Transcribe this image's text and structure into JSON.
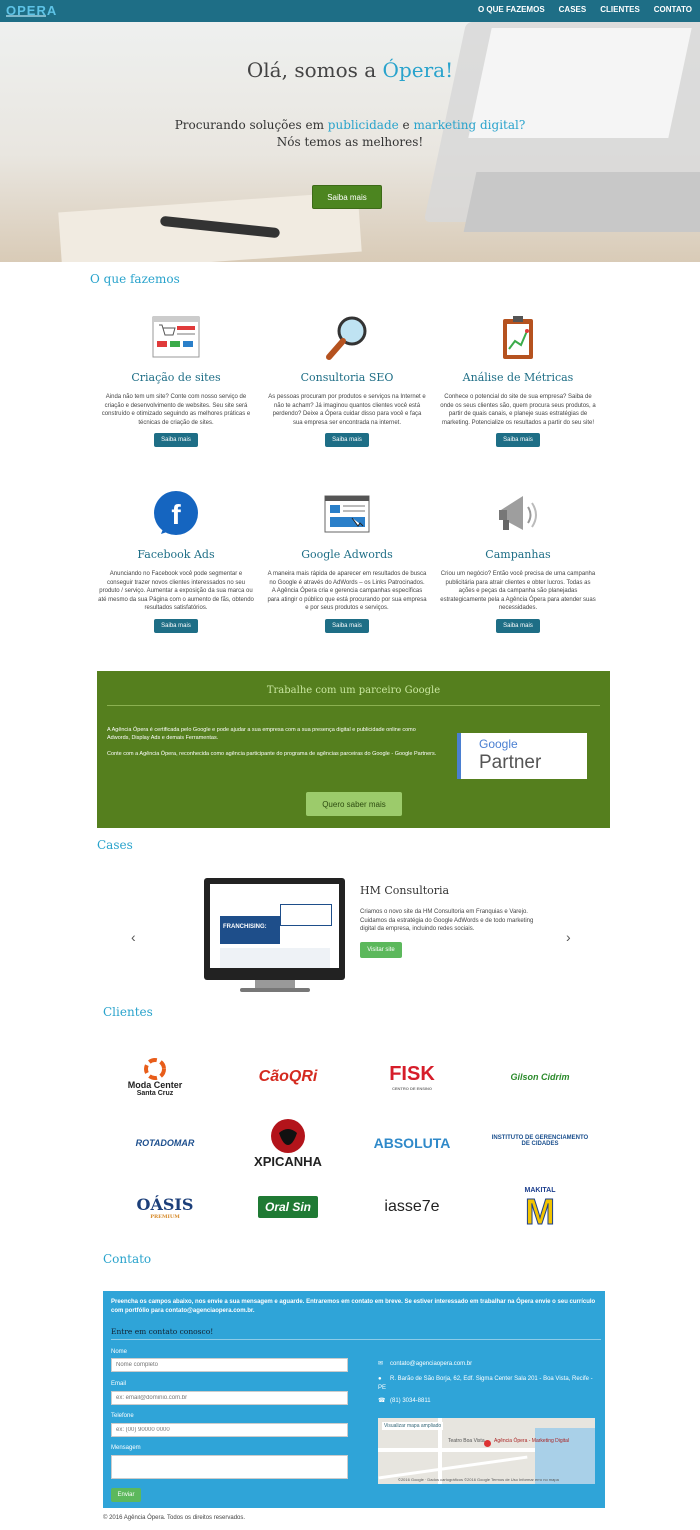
{
  "nav": {
    "logo": "OPERA",
    "links": [
      "O QUE FAZEMOS",
      "CASES",
      "CLIENTES",
      "CONTATO"
    ]
  },
  "hero": {
    "title_prefix": "Olá, somos a ",
    "title_highlight": "Ópera!",
    "sub_1": "Procurando soluções em ",
    "sub_hl1": "publicidade",
    "sub_2": " e ",
    "sub_hl2": "marketing digital?",
    "sub_line2": "Nós temos as melhores!",
    "button": "Saiba mais"
  },
  "services": {
    "title": "O que fazemos",
    "items": [
      {
        "icon": "shopping-site-icon",
        "title": "Criação de sites",
        "text": "Ainda não tem um site? Conte com nosso serviço de criação e desenvolvimento de websites. Seu site será construído e otimizado seguindo as melhores práticas e técnicas de criação de sites.",
        "button": "Saiba mais"
      },
      {
        "icon": "magnifier-icon",
        "title": "Consultoria SEO",
        "text": "As pessoas procuram por produtos e serviços na Internet e não te acham? Já imaginou quantos clientes você está perdendo? Deixe a Ópera cuidar disso para você e faça sua empresa ser encontrada na internet.",
        "button": "Saiba mais"
      },
      {
        "icon": "clipboard-chart-icon",
        "title": "Análise de Métricas",
        "text": "Conhece o potencial do site de sua empresa? Saiba de onde os seus clientes são, quem procura seus produtos, a partir de quais canais, e planeje suas estratégias de marketing. Potencialize os resultados a partir do seu site!",
        "button": "Saiba mais"
      },
      {
        "icon": "facebook-icon",
        "title": "Facebook Ads",
        "text": "Anunciando no Facebook você pode segmentar e conseguir trazer novos clientes interessados no seu produto / serviço. Aumentar a exposição da sua marca ou até mesmo da sua Página com o aumento de fãs, obtendo resultados satisfatórios.",
        "button": "Saiba mais"
      },
      {
        "icon": "browser-ad-icon",
        "title": "Google Adwords",
        "text": "A maneira mais rápida de aparecer em resultados de busca no Google é através do AdWords – os Links Patrocinados. A Agência Ópera cria e gerencia campanhas específicas para atingir o público que está procurando por sua empresa e por seus produtos e serviços.",
        "button": "Saiba mais"
      },
      {
        "icon": "megaphone-icon",
        "title": "Campanhas",
        "text": "Criou um negócio? Então você precisa de uma campanha publicitária para atrair clientes e obter lucros. Todas as ações e peças da campanha são planejadas estrategicamente pela a Agência Ópera para atender suas necessidades.",
        "button": "Saiba mais"
      }
    ]
  },
  "partner": {
    "title": "Trabalhe com um parceiro Google",
    "p1": "A Agência Ópera é certificada pelo Google e pode ajudar a sua empresa com a sua presença digital e publicidade online como Adwords, Display Ads e demais Ferramentas.",
    "p2": "Conte com a Agência Ópera, reconhecida como agência participante do programa de agências parceiras do Google - Google Partners.",
    "badge_google": "Google",
    "badge_partner": "Partner",
    "button": "Quero saber mais"
  },
  "cases": {
    "title": "Cases",
    "case_title": "HM Consultoria",
    "case_text": "Criamos o novo site da HM Consultoria em Franquias e Varejo. Cuidamos da estratégia do Google AdWords e de todo marketing digital da empresa, incluindo redes sociais.",
    "button": "Visitar site",
    "screen_headline": "FRANCHISING:",
    "prev": "‹",
    "next": "›"
  },
  "clients": {
    "title": "Clientes",
    "logos": [
      {
        "line1": "Moda Center",
        "line2": "Santa Cruz",
        "color": "#222"
      },
      {
        "line1": "CãoQRi",
        "line2": "",
        "color": "#d42a1f"
      },
      {
        "line1": "FISK",
        "line2": "CENTRO DE ENSINO",
        "color": "#d61d2a"
      },
      {
        "line1": "Gilson Cidrim",
        "line2": "",
        "color": "#2a8a2a"
      },
      {
        "line1": "ROTADOMAR",
        "line2": "",
        "color": "#1d4f8e"
      },
      {
        "line1": "XPICANHA",
        "line2": "",
        "color": "#222"
      },
      {
        "line1": "ABSOLUTA",
        "line2": "",
        "color": "#2f89c9"
      },
      {
        "line1": "INSTITUTO DE GERENCIAMENTO",
        "line2": "DE CIDADES",
        "color": "#1a4f8e"
      },
      {
        "line1": "OÁSIS",
        "line2": "PREMIUM",
        "color": "#1c3f7a"
      },
      {
        "line1": "Oral Sin",
        "line2": "",
        "color": "#1f7a34"
      },
      {
        "line1": "iasse7e",
        "line2": "",
        "color": "#222"
      },
      {
        "line1": "MAKITAL",
        "line2": "M",
        "color": "#1d3f8e"
      }
    ]
  },
  "contact": {
    "title": "Contato",
    "intro": "Preencha os campos abaixo, nos envie a sua mensagem e aguarde. Entraremos em contato em breve. Se estiver interessado em trabalhar na Ópera envie o seu currículo com portfólio para contato@agenciaopera.com.br.",
    "subtitle": "Entre em contato conosco!",
    "name_label": "Nome",
    "name_placeholder": "Nome completo",
    "email_label": "Email",
    "email_placeholder": "ex: email@dominio.com.br",
    "phone_label": "Telefone",
    "phone_placeholder": "ex: (00) 90000 0000",
    "message_label": "Mensagem",
    "submit": "Enviar",
    "email": "contato@agenciaopera.com.br",
    "address": "R. Barão de São Borja, 62, Edf. Sigma Center Sala 201 - Boa Vista, Recife - PE",
    "phone": "(81) 3034-8811",
    "map_link": "Visualizar mapa ampliado",
    "map_place": "Agência Ópera - Marketing Digital",
    "map_credit": "©2016 Google · Dados cartográficos ©2016 Google  Termos de Uso  Informar erro no mapa",
    "map_street": "Teatro Boa Vista"
  },
  "footer": {
    "text": "© 2016 Agência Ópera. Todos os direitos reservados."
  }
}
